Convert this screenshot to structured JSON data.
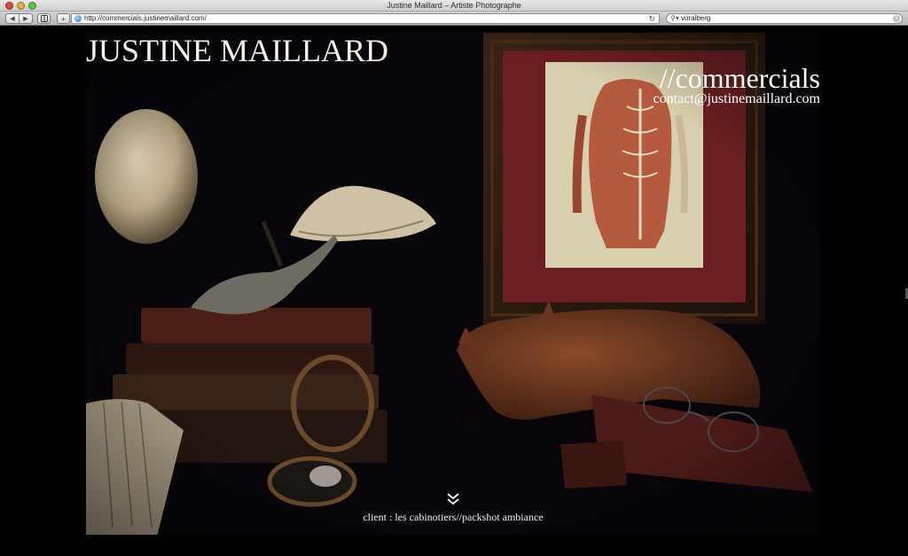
{
  "browser": {
    "window_title": "Justine Maillard – Artiste Photographe",
    "url": "http://commercials.justinemaillard.com/",
    "search_value": "voralberg",
    "icons": {
      "back": "back-arrow-icon",
      "forward": "forward-arrow-icon",
      "add_bookmark": "plus-icon",
      "reload": "reload-icon",
      "search": "magnifier-icon",
      "clear": "clear-icon"
    },
    "traffic_colors": [
      "#e2463f",
      "#e1b33a",
      "#5fc341"
    ]
  },
  "site": {
    "title": "JUSTINE MAILLARD",
    "section": "//commercials",
    "contact": "contact@justinemaillard.com",
    "caption": "client : les cabinotiers//packshot ambiance"
  },
  "hero_photo": {
    "scroll_icon": "double-chevron-down-icon",
    "background": "#07050a"
  }
}
